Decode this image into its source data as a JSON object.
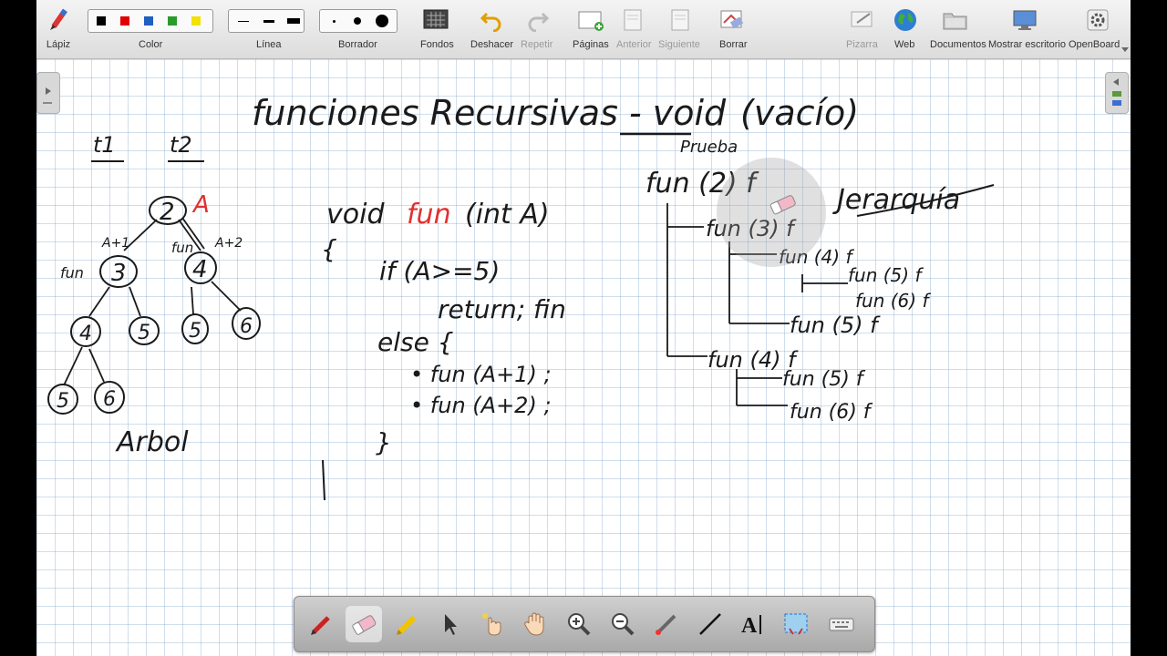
{
  "toolbar": {
    "pencil": "Lápiz",
    "color": "Color",
    "line": "Línea",
    "eraser": "Borrador",
    "backgrounds": "Fondos",
    "undo": "Deshacer",
    "redo": "Repetir",
    "pages": "Páginas",
    "previous": "Anterior",
    "next": "Siguiente",
    "erase": "Borrar",
    "board": "Pizarra",
    "web": "Web",
    "documents": "Documentos",
    "show_desktop": "Mostrar escritorio",
    "app": "OpenBoard"
  },
  "colors": {
    "black": "#000000",
    "red": "#e00000",
    "blue": "#1f5fbf",
    "green": "#2a9a2a",
    "yellow": "#f4e100",
    "ink_red": "#e03030",
    "accent_blue": "#2a6fd6"
  },
  "board": {
    "title": "funciones Recursivas - void",
    "title_paren": "(vacío)",
    "t1": "t1",
    "t2": "t2",
    "tree_root": "2",
    "tree_label_A": "A",
    "edge_left": "A+1",
    "edge_right": "A+2",
    "fun_left": "fun",
    "fun_right": "fun",
    "tree_nodes": [
      "3",
      "4",
      "4",
      "5",
      "5",
      "6",
      "5",
      "6"
    ],
    "tree_caption": "Arbol",
    "code_line1_void": "void",
    "code_line1_fun": "fun",
    "code_line1_args": "(int A)",
    "code_open": "{",
    "code_if": "if (A>=5)",
    "code_return": "return; fin",
    "code_else": "else {",
    "code_call1": "• fun (A+1) ;",
    "code_call2": "• fun (A+2) ;",
    "code_close": "}",
    "hier_test": "Prueba",
    "hier_root": "fun (2) f",
    "hier_title": "Jerarquía",
    "hier_items": [
      "fun (3) f",
      "fun (4) f",
      "fun (5) f",
      "fun (6) f",
      "fun (5) f",
      "fun (4) f",
      "fun (5) f",
      "fun (6) f"
    ]
  }
}
